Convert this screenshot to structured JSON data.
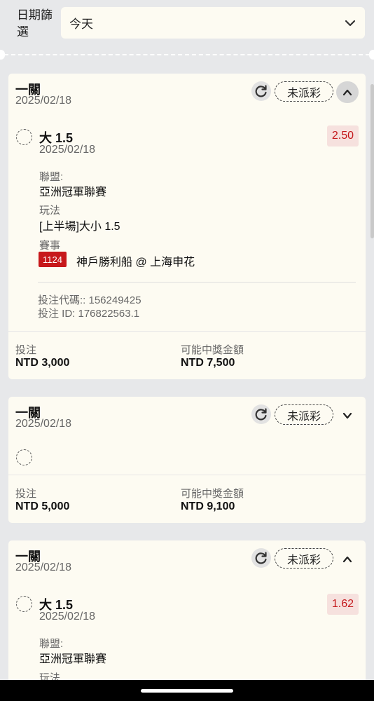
{
  "filter": {
    "label": "日期篩選",
    "value": "今天"
  },
  "labels": {
    "league": "聯盟:",
    "market": "玩法",
    "event": "賽事",
    "stake": "投注",
    "potential": "可能中獎金額"
  },
  "cards": [
    {
      "title": "一關",
      "date": "2025/02/18",
      "status": "未派彩",
      "expanded": true,
      "selection": {
        "name": "大 1.5",
        "date": "2025/02/18",
        "odds": "2.50",
        "league": "亞洲冠軍聯賽",
        "market": "[上半場]大小 1.5",
        "match_code": "1124",
        "match_name": "神戶勝利船 @ 上海申花"
      },
      "bet_code": "投注代碼:: 156249425",
      "bet_id": "投注 ID: 176822563.1",
      "stake": "NTD 3,000",
      "potential": "NTD 7,500"
    },
    {
      "title": "一關",
      "date": "2025/02/18",
      "status": "未派彩",
      "expanded": false,
      "stake": "NTD 5,000",
      "potential": "NTD 9,100"
    },
    {
      "title": "一關",
      "date": "2025/02/18",
      "status": "未派彩",
      "expanded": true,
      "selection": {
        "name": "大 1.5",
        "date": "2025/02/18",
        "odds": "1.62",
        "league": "亞洲冠軍聯賽",
        "market_label_partial": "玩法"
      }
    }
  ],
  "colors": {
    "background": "#e7e8ea",
    "card": "#fdfbf2",
    "odds_text": "#c4181b",
    "match_badge": "#c7181b"
  },
  "icons": [
    "chevron-down-icon",
    "refresh-icon",
    "chevron-up-icon",
    "radio-icon"
  ]
}
